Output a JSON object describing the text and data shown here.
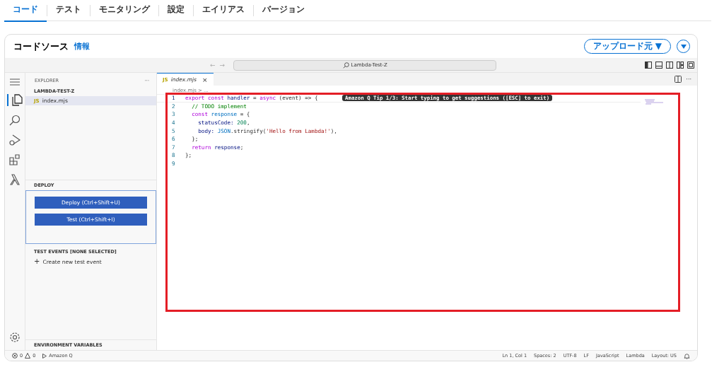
{
  "page_tabs": [
    {
      "label": "コード",
      "selected": true
    },
    {
      "label": "テスト",
      "selected": false
    },
    {
      "label": "モニタリング",
      "selected": false
    },
    {
      "label": "設定",
      "selected": false
    },
    {
      "label": "エイリアス",
      "selected": false
    },
    {
      "label": "バージョン",
      "selected": false
    }
  ],
  "panel": {
    "title": "コードソース",
    "info_link": "情報",
    "upload_button": "アップロード元 ▼"
  },
  "toolbar": {
    "nav_back": "←",
    "nav_forward": "→",
    "search": "Lambda-Test-Z"
  },
  "explorer": {
    "title": "EXPLORER",
    "more": "···",
    "folder": "LAMBDA-TEST-Z",
    "files": [
      {
        "icon": "JS",
        "name": "index.mjs",
        "selected": true
      }
    ]
  },
  "deploy": {
    "title": "DEPLOY",
    "buttons": [
      "Deploy (Ctrl+Shift+U)",
      "Test (Ctrl+Shift+I)"
    ]
  },
  "test_events": {
    "title": "TEST EVENTS [NONE SELECTED]",
    "create_icon": "+",
    "create": "Create new test event"
  },
  "env_vars": {
    "title": "ENVIRONMENT VARIABLES"
  },
  "editor": {
    "tab": {
      "icon": "JS",
      "name": "index.mjs",
      "close": "×"
    },
    "breadcrumb": "index.mjs > ...",
    "tip": "Amazon Q Tip 1/3: Start typing to get suggestions ([ESC] to exit)",
    "lines": [
      {
        "number": "1",
        "tokens": [
          {
            "kind": "keyword",
            "text": "export const "
          },
          {
            "kind": "variable",
            "text": "handler"
          },
          {
            "kind": "plain",
            "text": " = "
          },
          {
            "kind": "keyword",
            "text": "async"
          },
          {
            "kind": "plain",
            "text": " (event) => {"
          }
        ]
      },
      {
        "number": "2",
        "tokens": [
          {
            "kind": "comment",
            "text": "  // TODO implement"
          }
        ]
      },
      {
        "number": "3",
        "tokens": [
          {
            "kind": "keyword",
            "text": "  const "
          },
          {
            "kind": "constant",
            "text": "response"
          },
          {
            "kind": "plain",
            "text": " = {"
          }
        ]
      },
      {
        "number": "4",
        "tokens": [
          {
            "kind": "variable",
            "text": "    statusCode: "
          },
          {
            "kind": "number",
            "text": "200"
          },
          {
            "kind": "plain",
            "text": ","
          }
        ]
      },
      {
        "number": "5",
        "tokens": [
          {
            "kind": "variable",
            "text": "    body: "
          },
          {
            "kind": "constant",
            "text": "JSON"
          },
          {
            "kind": "plain",
            "text": ".stringify("
          },
          {
            "kind": "string",
            "text": "'Hello from Lambda!'"
          },
          {
            "kind": "plain",
            "text": "),"
          }
        ]
      },
      {
        "number": "6",
        "tokens": [
          {
            "kind": "plain",
            "text": "  };"
          }
        ]
      },
      {
        "number": "7",
        "tokens": [
          {
            "kind": "keyword",
            "text": "  return "
          },
          {
            "kind": "variable",
            "text": "response"
          },
          {
            "kind": "plain",
            "text": ";"
          }
        ]
      },
      {
        "number": "8",
        "tokens": [
          {
            "kind": "plain",
            "text": "};"
          }
        ]
      },
      {
        "number": "9"
      }
    ]
  },
  "status_bar": {
    "errors": "0",
    "warnings": "0",
    "amazon_q": "Amazon Q",
    "right": [
      "Ln 1, Col 1",
      "Spaces: 2",
      "UTF-8",
      "LF",
      "JavaScript",
      "Lambda",
      "Layout: US"
    ]
  }
}
